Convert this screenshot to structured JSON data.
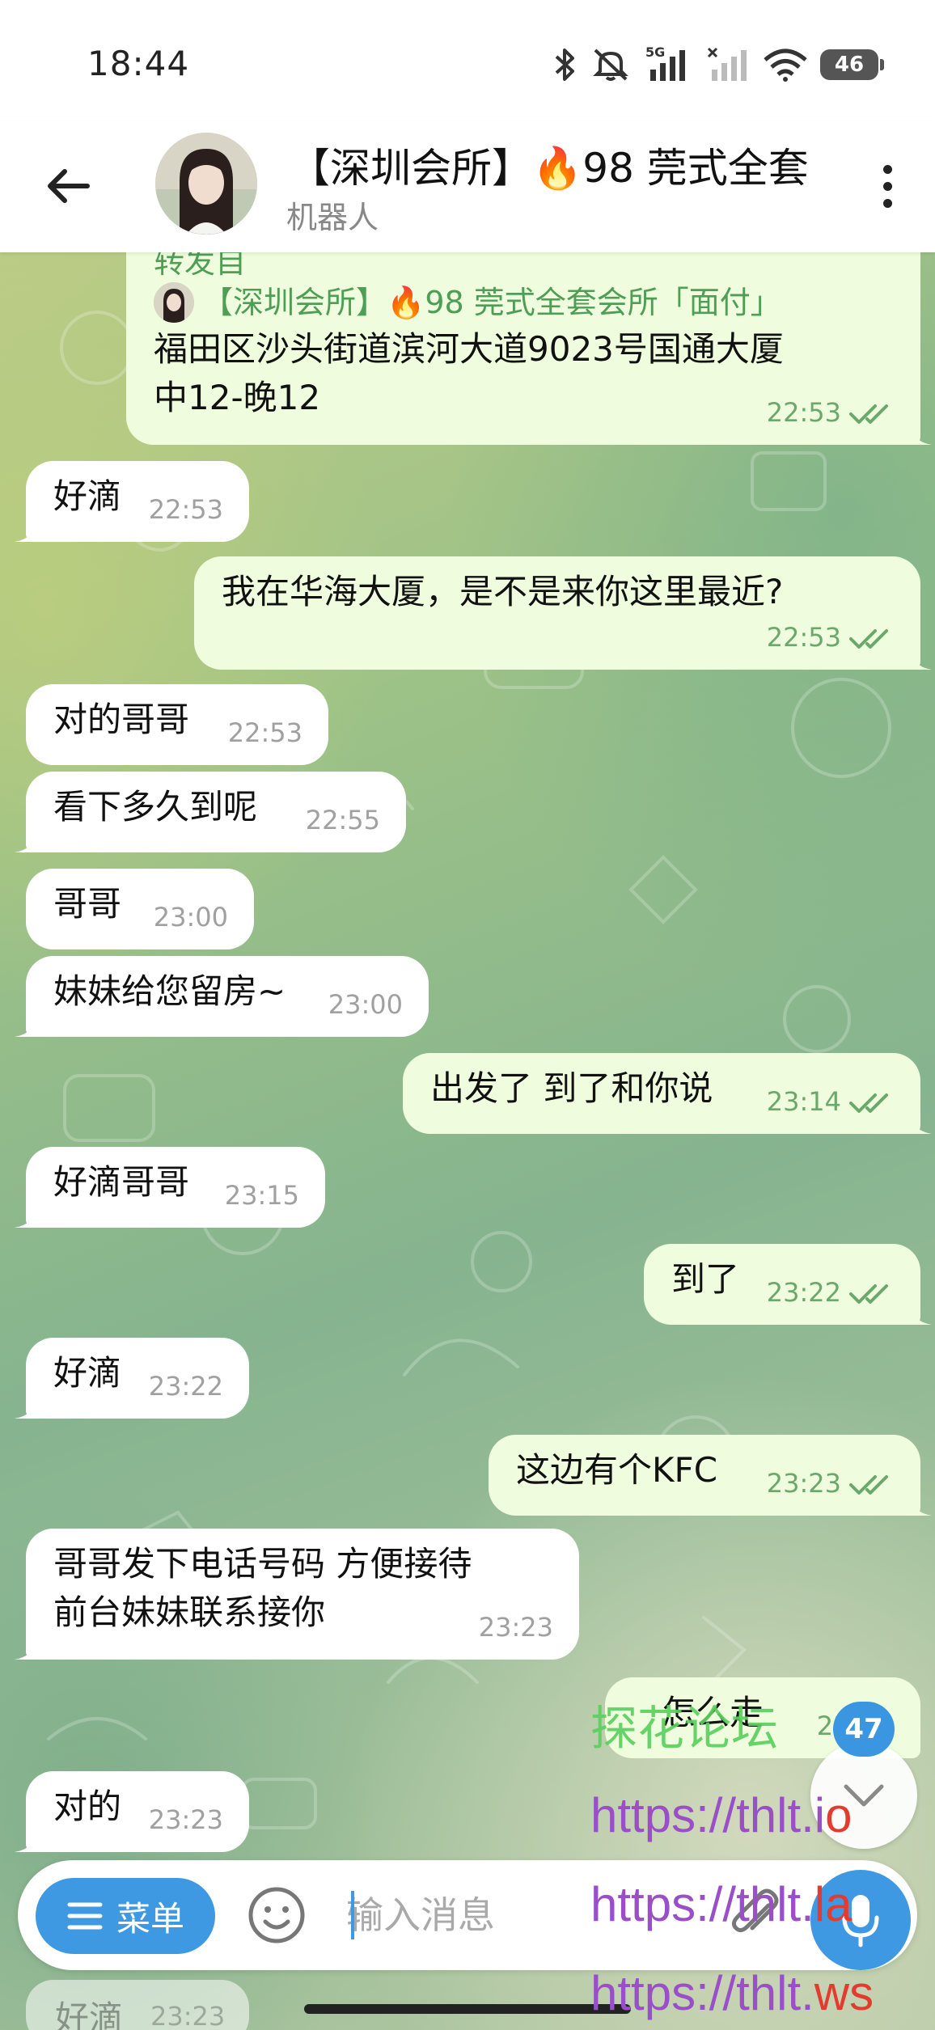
{
  "status_bar": {
    "time": "18:44",
    "network": "5G",
    "battery": "46",
    "icons": [
      "bluetooth-icon",
      "mute-icon",
      "signal-icon",
      "signal-icon",
      "wifi-icon",
      "battery-icon"
    ]
  },
  "header": {
    "title": "【深圳会所】🔥98 莞式全套",
    "subtitle": "机器人"
  },
  "messages": [
    {
      "dir": "out",
      "forward_label": "转发自",
      "forward_from": "【深圳会所】🔥98 莞式全套会所「面付」",
      "text_line1": "福田区沙头街道滨河大道9023号国通大厦",
      "text_line2": "中12-晚12",
      "time": "22:53"
    },
    {
      "dir": "in",
      "text": "好滴",
      "time": "22:53"
    },
    {
      "dir": "out",
      "text": "我在华海大厦，是不是来你这里最近?",
      "time": "22:53"
    },
    {
      "dir": "in",
      "text": "对的哥哥",
      "time": "22:53"
    },
    {
      "dir": "in",
      "text": "看下多久到呢",
      "time": "22:55"
    },
    {
      "dir": "in",
      "text": "哥哥",
      "time": "23:00"
    },
    {
      "dir": "in",
      "text": "妹妹给您留房~",
      "time": "23:00"
    },
    {
      "dir": "out",
      "text": "出发了 到了和你说",
      "time": "23:14"
    },
    {
      "dir": "in",
      "text": "好滴哥哥",
      "time": "23:15"
    },
    {
      "dir": "out",
      "text": "到了",
      "time": "23:22"
    },
    {
      "dir": "in",
      "text": "好滴",
      "time": "23:22"
    },
    {
      "dir": "out",
      "text": "这边有个KFC",
      "time": "23:23"
    },
    {
      "dir": "in",
      "text_line1": "哥哥发下电话号码 方便接待",
      "text_line2": "前台妹妹联系接你",
      "time": "23:23"
    },
    {
      "dir": "out",
      "text": "怎么走",
      "time": "23:23"
    },
    {
      "dir": "in",
      "text": "对的",
      "time": "23:23"
    },
    {
      "dir": "in",
      "text": "好滴",
      "time": "23:23"
    }
  ],
  "unread_count": "47",
  "input": {
    "menu_label": "菜单",
    "placeholder": "输入消息"
  },
  "watermark": {
    "line1": "探花论坛",
    "line2_main": "https://thlt.i",
    "line2_red": "o",
    "line3_main": "https://thlt.",
    "line3_red": "la",
    "line4_main": "https://thlt.",
    "line4_red": "ws"
  },
  "colors": {
    "accent": "#3e98e2",
    "outgoing_bubble": "#effdde",
    "incoming_bubble": "#ffffff",
    "check_green": "#6aa86b",
    "forward_green": "#4e9e55"
  }
}
